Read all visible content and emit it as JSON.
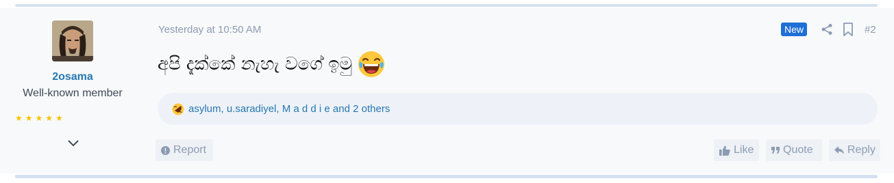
{
  "post": {
    "username": "2osama",
    "user_title": "Well-known member",
    "stars": "★★★★★",
    "time": "Yesterday at 10:50 AM",
    "new_badge": "New",
    "post_number": "#2",
    "message": "අපි දැක්කේ නැහැ වගේ ඉමු",
    "reactions_text": "asylum, u.saradiyel, M a d d i e and 2 others"
  },
  "actions": {
    "report": "Report",
    "like": "Like",
    "quote": "Quote",
    "reply": "Reply"
  },
  "colors": {
    "accent": "#2577b1",
    "badge": "#1f6fd6",
    "muted": "#8c9bb3",
    "separator": "#d5e1f1"
  },
  "icons": [
    "share-icon",
    "bookmark-icon",
    "chevron-down-icon",
    "laughing-emoji",
    "rofl-emoji",
    "alert-icon",
    "thumbs-up-icon",
    "quote-icon",
    "reply-icon"
  ]
}
